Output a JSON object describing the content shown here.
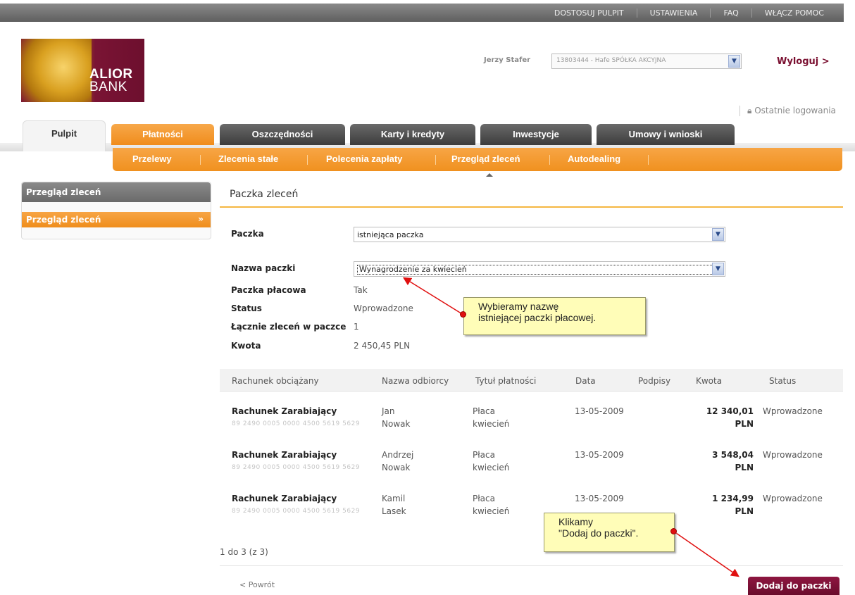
{
  "topnav": [
    "DOSTOSUJ PULPIT",
    "USTAWIENIA",
    "FAQ",
    "WŁĄCZ POMOC"
  ],
  "logo": {
    "line1": "ALIOR",
    "line2": "BANK"
  },
  "user": {
    "name": "Jerzy Stafer",
    "account": "13803444 - Hafe SPÓŁKA AKCYJNA",
    "logout": "Wyloguj >",
    "last_logins": "Ostatnie logowania"
  },
  "tabs": [
    "Pulpit",
    "Płatności",
    "Oszczędności",
    "Karty i kredyty",
    "Inwestycje",
    "Umowy i wnioski"
  ],
  "subnav": [
    "Przelewy",
    "Zlecenia stałe",
    "Polecenia zapłaty",
    "Przegląd zleceń",
    "Autodealing"
  ],
  "sidebar": {
    "header": "Przegląd zleceń",
    "item": "Przegląd zleceń",
    "item_arrow": "»"
  },
  "page_title": "Paczka zleceń",
  "form": {
    "paczka_label": "Paczka",
    "paczka_value": "istniejąca paczka",
    "nazwa_label": "Nazwa paczki",
    "nazwa_value": "Wynagrodzenie za kwiecień",
    "placowa_label": "Paczka płacowa",
    "placowa_value": "Tak",
    "status_label": "Status",
    "status_value": "Wprowadzone",
    "count_label": "Łącznie zleceń w paczce",
    "count_value": "1",
    "kwota_label": "Kwota",
    "kwota_value": "2 450,45 PLN"
  },
  "table": {
    "headers": [
      "Rachunek obciążany",
      "Nazwa odbiorcy",
      "Tytuł płatności",
      "Data",
      "Podpisy",
      "Kwota",
      "Status"
    ],
    "rows": [
      {
        "account": "Rachunek Zarabiający",
        "number": "89 2490 0005 0000 4500 5619 5629",
        "recipient1": "Jan",
        "recipient2": "Nowak",
        "title1": "Płaca",
        "title2": "kwiecień",
        "date": "13-05-2009",
        "amount": "12 340,01",
        "currency": "PLN",
        "status": "Wprowadzone"
      },
      {
        "account": "Rachunek Zarabiający",
        "number": "89 2490 0005 0000 4500 5619 5629",
        "recipient1": "Andrzej",
        "recipient2": "Nowak",
        "title1": "Płaca",
        "title2": "kwiecień",
        "date": "13-05-2009",
        "amount": "3 548,04",
        "currency": "PLN",
        "status": "Wprowadzone"
      },
      {
        "account": "Rachunek Zarabiający",
        "number": "89 2490 0005 0000 4500 5619 5629",
        "recipient1": "Kamil",
        "recipient2": "Lasek",
        "title1": "Płaca",
        "title2": "kwiecień",
        "date": "13-05-2009",
        "amount": "1 234,99",
        "currency": "PLN",
        "status": "Wprowadzone"
      }
    ],
    "pager": "1 do 3 (z 3)"
  },
  "actions": {
    "back": "Powrót",
    "back_icon": "<",
    "add": "Dodaj do paczki"
  },
  "callouts": {
    "c1_line1": "Wybieramy nazwę",
    "c1_line2": "istniejącej paczki płacowej.",
    "c2_line1": "Klikamy",
    "c2_line2": "\"Dodaj do paczki\"."
  },
  "colors": {
    "brand": "#6d0f2e",
    "accent": "#f0911f",
    "callout": "#fffdb8",
    "pointer": "#e01010"
  }
}
